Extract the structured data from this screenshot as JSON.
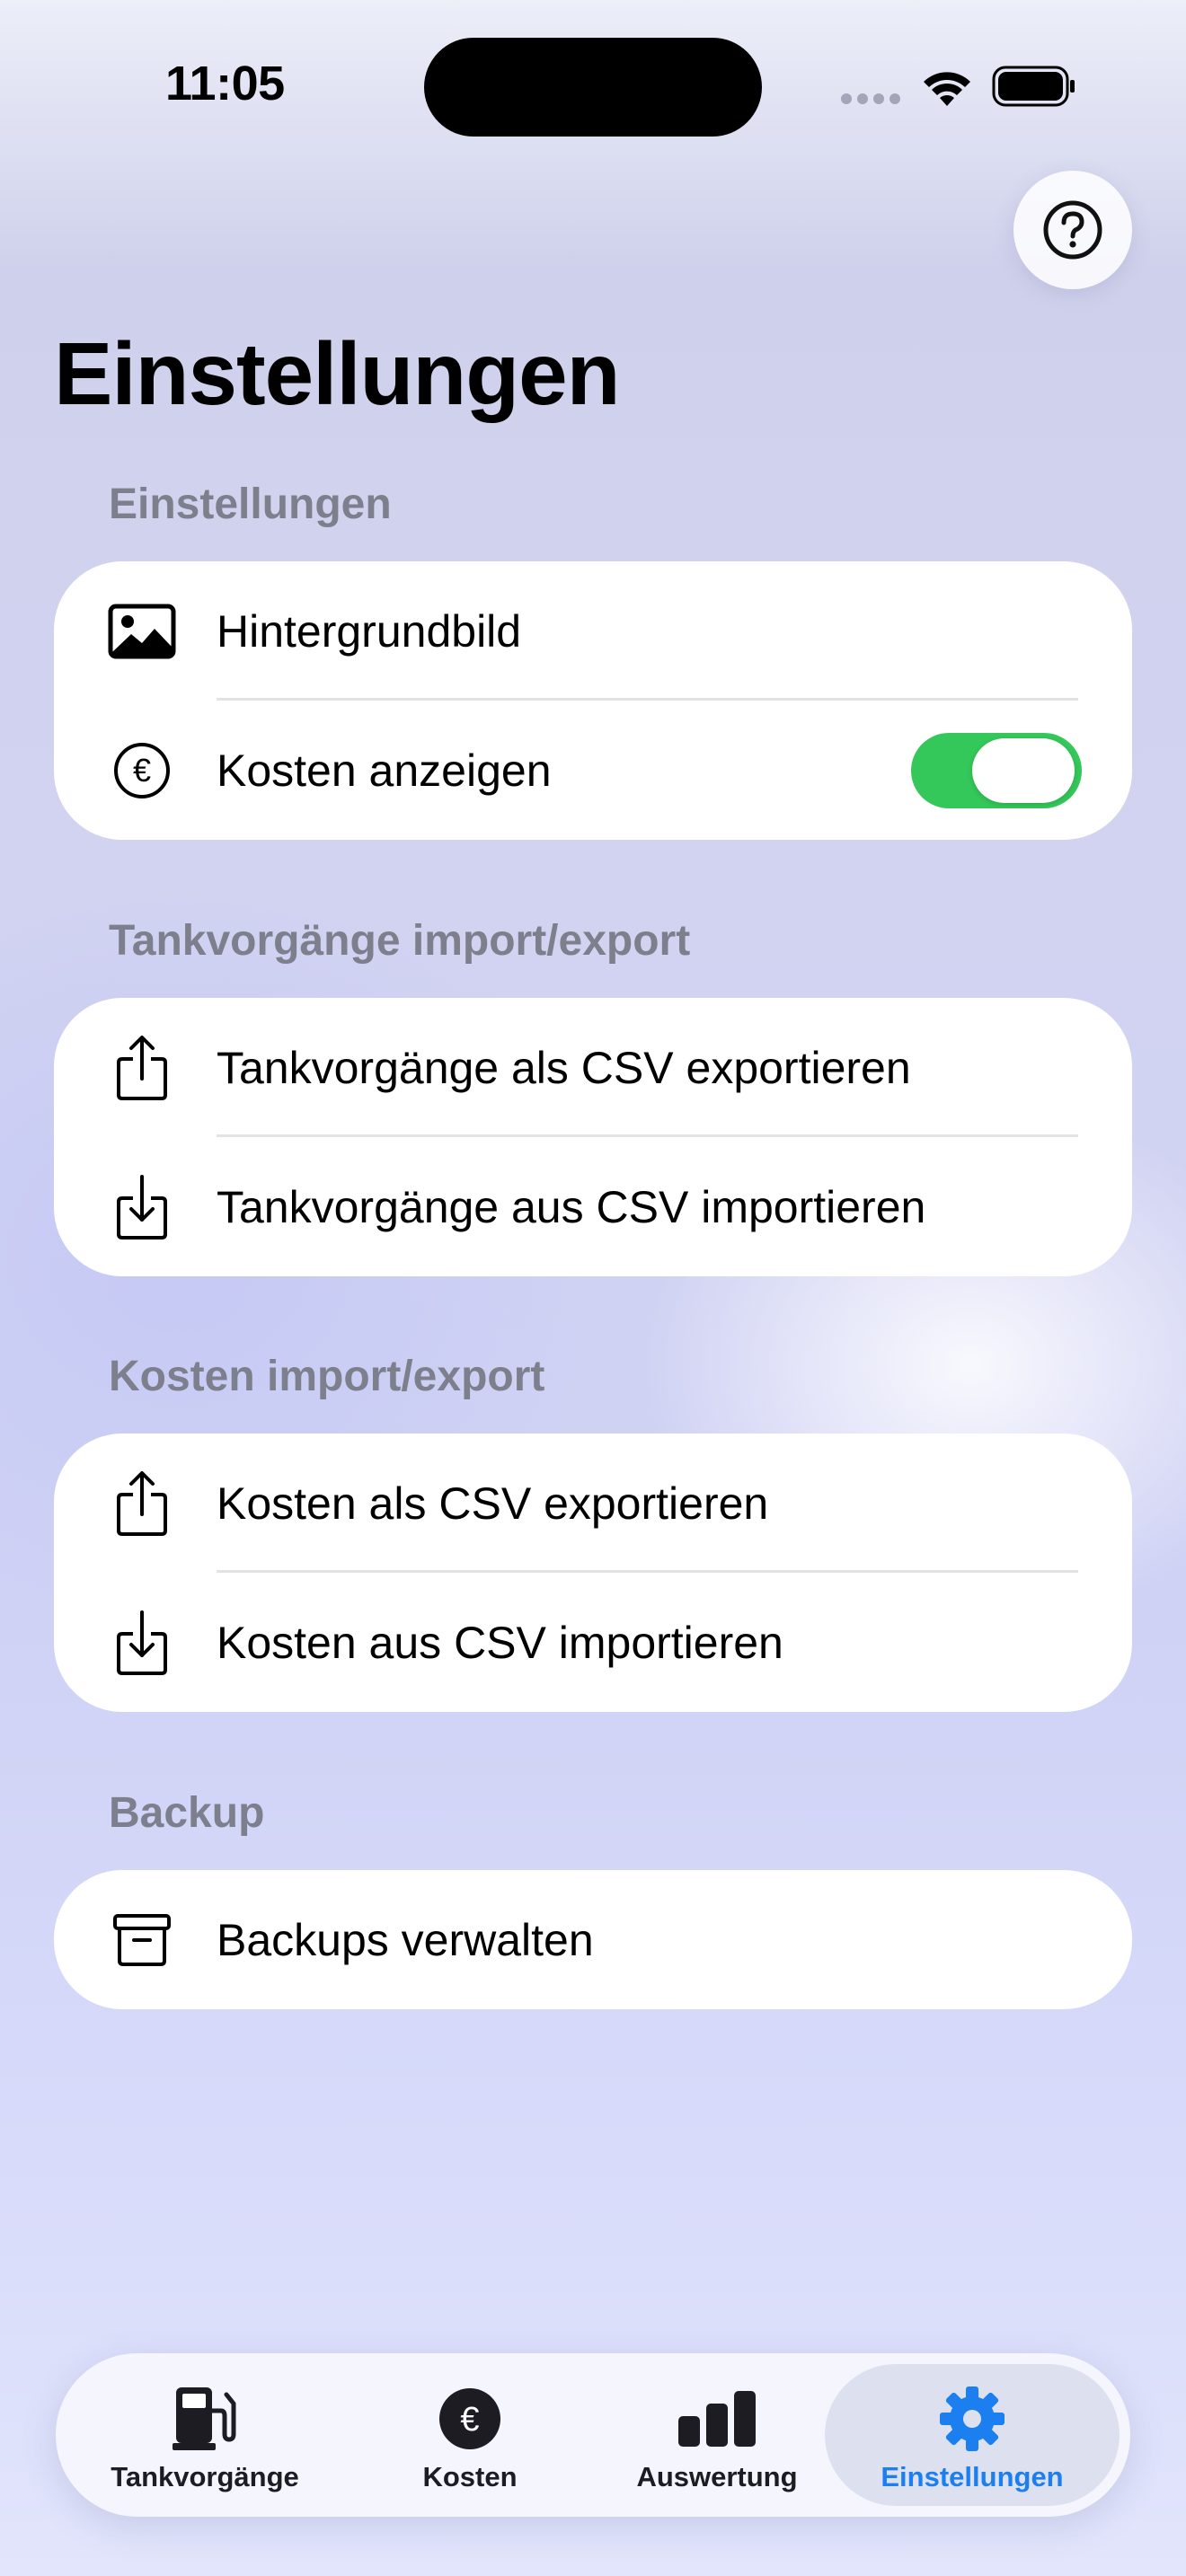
{
  "status_bar": {
    "time": "11:05"
  },
  "header": {
    "title": "Einstellungen",
    "help_icon": "question-circle-icon"
  },
  "sections": [
    {
      "header": "Einstellungen",
      "rows": [
        {
          "label": "Hintergrundbild",
          "icon": "photo-icon"
        },
        {
          "label": "Kosten anzeigen",
          "icon": "euro-circle-icon",
          "toggle": true
        }
      ]
    },
    {
      "header": "Tankvorgänge import/export",
      "rows": [
        {
          "label": "Tankvorgänge als CSV exportieren",
          "icon": "share-icon"
        },
        {
          "label": "Tankvorgänge aus CSV importieren",
          "icon": "import-icon"
        }
      ]
    },
    {
      "header": "Kosten import/export",
      "rows": [
        {
          "label": "Kosten als CSV exportieren",
          "icon": "share-icon"
        },
        {
          "label": "Kosten aus CSV importieren",
          "icon": "import-icon"
        }
      ]
    },
    {
      "header": "Backup",
      "rows": [
        {
          "label": "Backups verwalten",
          "icon": "archive-box-icon"
        }
      ]
    }
  ],
  "tabbar": {
    "tabs": [
      {
        "label": "Tankvorgänge",
        "icon": "fuel-pump-icon"
      },
      {
        "label": "Kosten",
        "icon": "euro-circle-icon"
      },
      {
        "label": "Auswertung",
        "icon": "bar-chart-icon"
      },
      {
        "label": "Einstellungen",
        "icon": "gear-icon",
        "selected": true
      }
    ]
  },
  "colors": {
    "accent": "#1c7ff0",
    "toggle_on": "#34c759",
    "section_header": "#7e7f8d"
  }
}
